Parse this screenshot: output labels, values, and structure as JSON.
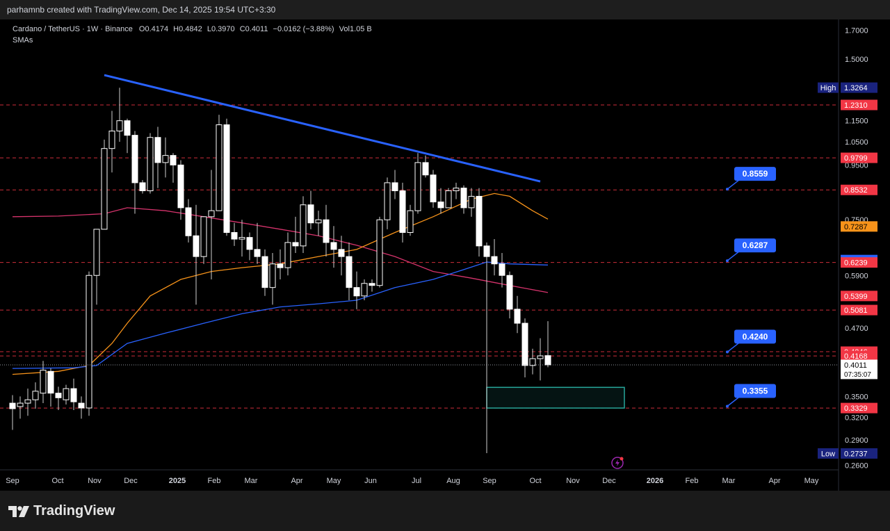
{
  "header": {
    "credit": "parhamnb created with TradingView.com, Dec 14, 2025 19:54 UTC+3:30"
  },
  "legend": {
    "symbol_line": "Cardano / TetherUS · 1W · Binance",
    "ohlc": {
      "open_label": "O",
      "open": "0.4174",
      "high_label": "H",
      "high": "0.4842",
      "low_label": "L",
      "low": "0.3970",
      "close_label": "C",
      "close": "0.4011",
      "change": "−0.0162 (−3.88%)",
      "vol_label": "Vol",
      "vol": "1.05 B"
    },
    "indicator": "SMAs"
  },
  "footer": {
    "brand": "TradingView"
  },
  "colors": {
    "background": "#000000",
    "candle_up": "#ffffff",
    "candle_down": "#ffffff",
    "wick": "#cfcfcf",
    "trendline": "#2962ff",
    "sma_orange": "#f7931a",
    "sma_red": "#d6336c",
    "sma_blue": "#2962ff",
    "level_line": "#f23645",
    "zone_border": "#26a69a"
  },
  "chart_data": {
    "type": "candlestick",
    "title": "Cardano / TetherUS · 1W · Binance",
    "y_scale": "log",
    "ylim": [
      0.255,
      1.78
    ],
    "y_ticks": [
      "1.7000",
      "1.5000",
      "1.1500",
      "1.0500",
      "0.9500",
      "0.7500",
      "0.5900",
      "0.4700",
      "0.3500",
      "0.3200",
      "0.2900",
      "0.2600"
    ],
    "x_ticks": [
      "Sep",
      "Oct",
      "Nov",
      "Dec",
      "2025",
      "Feb",
      "Mar",
      "Apr",
      "May",
      "Jun",
      "Jul",
      "Aug",
      "Sep",
      "Oct",
      "Nov",
      "Dec",
      "2026",
      "Feb",
      "Mar",
      "Apr",
      "May"
    ],
    "candles": [
      {
        "o": 0.34,
        "h": 0.352,
        "l": 0.303,
        "c": 0.332
      },
      {
        "o": 0.335,
        "h": 0.35,
        "l": 0.318,
        "c": 0.34
      },
      {
        "o": 0.34,
        "h": 0.362,
        "l": 0.322,
        "c": 0.345
      },
      {
        "o": 0.345,
        "h": 0.372,
        "l": 0.332,
        "c": 0.358
      },
      {
        "o": 0.355,
        "h": 0.408,
        "l": 0.34,
        "c": 0.392
      },
      {
        "o": 0.39,
        "h": 0.395,
        "l": 0.335,
        "c": 0.355
      },
      {
        "o": 0.355,
        "h": 0.365,
        "l": 0.33,
        "c": 0.348
      },
      {
        "o": 0.345,
        "h": 0.368,
        "l": 0.338,
        "c": 0.362
      },
      {
        "o": 0.362,
        "h": 0.378,
        "l": 0.33,
        "c": 0.342
      },
      {
        "o": 0.34,
        "h": 0.35,
        "l": 0.318,
        "c": 0.333
      },
      {
        "o": 0.333,
        "h": 0.6,
        "l": 0.322,
        "c": 0.59
      },
      {
        "o": 0.59,
        "h": 0.72,
        "l": 0.52,
        "c": 0.72
      },
      {
        "o": 0.72,
        "h": 1.06,
        "l": 0.72,
        "c": 1.02
      },
      {
        "o": 1.02,
        "h": 1.2,
        "l": 0.92,
        "c": 1.1
      },
      {
        "o": 1.1,
        "h": 1.326,
        "l": 1.05,
        "c": 1.15
      },
      {
        "o": 1.15,
        "h": 1.16,
        "l": 1.0,
        "c": 1.08
      },
      {
        "o": 1.08,
        "h": 1.1,
        "l": 0.77,
        "c": 0.88
      },
      {
        "o": 0.88,
        "h": 0.89,
        "l": 0.84,
        "c": 0.85
      },
      {
        "o": 0.85,
        "h": 1.09,
        "l": 0.84,
        "c": 1.07
      },
      {
        "o": 1.07,
        "h": 1.12,
        "l": 0.86,
        "c": 0.96
      },
      {
        "o": 0.96,
        "h": 1.07,
        "l": 0.9,
        "c": 0.99
      },
      {
        "o": 0.99,
        "h": 1.0,
        "l": 0.88,
        "c": 0.95
      },
      {
        "o": 0.95,
        "h": 0.97,
        "l": 0.75,
        "c": 0.79
      },
      {
        "o": 0.79,
        "h": 0.82,
        "l": 0.68,
        "c": 0.7
      },
      {
        "o": 0.7,
        "h": 0.8,
        "l": 0.52,
        "c": 0.64
      },
      {
        "o": 0.64,
        "h": 0.76,
        "l": 0.62,
        "c": 0.76
      },
      {
        "o": 0.76,
        "h": 0.93,
        "l": 0.58,
        "c": 0.78
      },
      {
        "o": 0.78,
        "h": 1.18,
        "l": 0.78,
        "c": 1.13
      },
      {
        "o": 1.13,
        "h": 1.16,
        "l": 0.7,
        "c": 0.71
      },
      {
        "o": 0.71,
        "h": 0.74,
        "l": 0.67,
        "c": 0.69
      },
      {
        "o": 0.69,
        "h": 0.75,
        "l": 0.64,
        "c": 0.695
      },
      {
        "o": 0.695,
        "h": 0.71,
        "l": 0.63,
        "c": 0.66
      },
      {
        "o": 0.66,
        "h": 0.74,
        "l": 0.62,
        "c": 0.64
      },
      {
        "o": 0.64,
        "h": 0.66,
        "l": 0.54,
        "c": 0.56
      },
      {
        "o": 0.56,
        "h": 0.65,
        "l": 0.52,
        "c": 0.62
      },
      {
        "o": 0.62,
        "h": 0.66,
        "l": 0.58,
        "c": 0.61
      },
      {
        "o": 0.61,
        "h": 0.71,
        "l": 0.59,
        "c": 0.68
      },
      {
        "o": 0.68,
        "h": 0.76,
        "l": 0.65,
        "c": 0.67
      },
      {
        "o": 0.67,
        "h": 0.83,
        "l": 0.65,
        "c": 0.8
      },
      {
        "o": 0.8,
        "h": 0.85,
        "l": 0.72,
        "c": 0.74
      },
      {
        "o": 0.74,
        "h": 0.78,
        "l": 0.7,
        "c": 0.75
      },
      {
        "o": 0.75,
        "h": 0.8,
        "l": 0.64,
        "c": 0.68
      },
      {
        "o": 0.68,
        "h": 0.73,
        "l": 0.61,
        "c": 0.66
      },
      {
        "o": 0.66,
        "h": 0.7,
        "l": 0.59,
        "c": 0.64
      },
      {
        "o": 0.64,
        "h": 0.68,
        "l": 0.53,
        "c": 0.56
      },
      {
        "o": 0.56,
        "h": 0.6,
        "l": 0.51,
        "c": 0.54
      },
      {
        "o": 0.54,
        "h": 0.58,
        "l": 0.53,
        "c": 0.57
      },
      {
        "o": 0.57,
        "h": 0.58,
        "l": 0.55,
        "c": 0.565
      },
      {
        "o": 0.565,
        "h": 0.76,
        "l": 0.56,
        "c": 0.75
      },
      {
        "o": 0.75,
        "h": 0.9,
        "l": 0.72,
        "c": 0.88
      },
      {
        "o": 0.88,
        "h": 0.93,
        "l": 0.82,
        "c": 0.85
      },
      {
        "o": 0.85,
        "h": 0.88,
        "l": 0.68,
        "c": 0.71
      },
      {
        "o": 0.71,
        "h": 0.8,
        "l": 0.7,
        "c": 0.78
      },
      {
        "o": 0.78,
        "h": 1.0,
        "l": 0.77,
        "c": 0.96
      },
      {
        "o": 0.96,
        "h": 0.99,
        "l": 0.9,
        "c": 0.91
      },
      {
        "o": 0.91,
        "h": 0.93,
        "l": 0.79,
        "c": 0.81
      },
      {
        "o": 0.81,
        "h": 0.86,
        "l": 0.77,
        "c": 0.79
      },
      {
        "o": 0.79,
        "h": 0.86,
        "l": 0.79,
        "c": 0.85
      },
      {
        "o": 0.85,
        "h": 0.88,
        "l": 0.82,
        "c": 0.86
      },
      {
        "o": 0.86,
        "h": 0.87,
        "l": 0.77,
        "c": 0.79
      },
      {
        "o": 0.79,
        "h": 0.86,
        "l": 0.76,
        "c": 0.83
      },
      {
        "o": 0.83,
        "h": 0.86,
        "l": 0.64,
        "c": 0.67
      },
      {
        "o": 0.67,
        "h": 0.68,
        "l": 0.274,
        "c": 0.64
      },
      {
        "o": 0.64,
        "h": 0.69,
        "l": 0.59,
        "c": 0.62
      },
      {
        "o": 0.62,
        "h": 0.65,
        "l": 0.56,
        "c": 0.59
      },
      {
        "o": 0.59,
        "h": 0.6,
        "l": 0.49,
        "c": 0.51
      },
      {
        "o": 0.51,
        "h": 0.54,
        "l": 0.46,
        "c": 0.48
      },
      {
        "o": 0.48,
        "h": 0.49,
        "l": 0.38,
        "c": 0.4
      },
      {
        "o": 0.4,
        "h": 0.43,
        "l": 0.385,
        "c": 0.412
      },
      {
        "o": 0.412,
        "h": 0.45,
        "l": 0.375,
        "c": 0.417
      },
      {
        "o": 0.4174,
        "h": 0.4842,
        "l": 0.397,
        "c": 0.4011
      }
    ],
    "sma_series": [
      {
        "color": "#d6336c",
        "values": [
          [
            0,
            0.76
          ],
          [
            6,
            0.762
          ],
          [
            12,
            0.77
          ],
          [
            15,
            0.79
          ],
          [
            20,
            0.78
          ],
          [
            25,
            0.76
          ],
          [
            30,
            0.74
          ],
          [
            35,
            0.72
          ],
          [
            40,
            0.7
          ],
          [
            45,
            0.672
          ],
          [
            50,
            0.64
          ],
          [
            55,
            0.6
          ],
          [
            60,
            0.583
          ],
          [
            65,
            0.565
          ],
          [
            70,
            0.548
          ]
        ]
      },
      {
        "color": "#f7931a",
        "values": [
          [
            0,
            0.385
          ],
          [
            6,
            0.39
          ],
          [
            10,
            0.4
          ],
          [
            13,
            0.44
          ],
          [
            15,
            0.48
          ],
          [
            18,
            0.54
          ],
          [
            22,
            0.58
          ],
          [
            26,
            0.6
          ],
          [
            30,
            0.61
          ],
          [
            35,
            0.62
          ],
          [
            40,
            0.64
          ],
          [
            45,
            0.66
          ],
          [
            50,
            0.71
          ],
          [
            55,
            0.76
          ],
          [
            60,
            0.82
          ],
          [
            63,
            0.84
          ],
          [
            65,
            0.83
          ],
          [
            68,
            0.78
          ],
          [
            70,
            0.752
          ]
        ]
      },
      {
        "color": "#2962ff",
        "values": [
          [
            0,
            0.395
          ],
          [
            8,
            0.396
          ],
          [
            11,
            0.4
          ],
          [
            15,
            0.44
          ],
          [
            20,
            0.46
          ],
          [
            25,
            0.48
          ],
          [
            30,
            0.5
          ],
          [
            35,
            0.515
          ],
          [
            40,
            0.522
          ],
          [
            45,
            0.53
          ],
          [
            50,
            0.56
          ],
          [
            55,
            0.58
          ],
          [
            59,
            0.605
          ],
          [
            62,
            0.625
          ],
          [
            65,
            0.62
          ],
          [
            70,
            0.617
          ]
        ]
      }
    ],
    "trendline": {
      "from": [
        12,
        1.4
      ],
      "to": [
        69,
        0.885
      ]
    },
    "horizontal_levels": [
      "1.2310",
      "0.9799",
      "0.8532",
      "0.6239",
      "0.5081",
      "0.4246",
      "0.4168",
      "0.3329"
    ],
    "price_labels": [
      {
        "text": "1.3264",
        "value": 1.3264,
        "bg": "#1a237e",
        "prefix": "High"
      },
      {
        "text": "1.2310",
        "value": 1.231,
        "bg": "#f23645"
      },
      {
        "text": "0.9799",
        "value": 0.9799,
        "bg": "#f23645"
      },
      {
        "text": "0.8532",
        "value": 0.8532,
        "bg": "#f23645"
      },
      {
        "text": "0.7287",
        "value": 0.7287,
        "bg": "#f7931a",
        "fg": "#000000"
      },
      {
        "text": "0.6304",
        "value": 0.6304,
        "bg": "#2962ff"
      },
      {
        "text": "0.6239",
        "value": 0.6239,
        "bg": "#f23645"
      },
      {
        "text": "0.5399",
        "value": 0.5399,
        "bg": "#f23645"
      },
      {
        "text": "0.5081",
        "value": 0.5081,
        "bg": "#f23645"
      },
      {
        "text": "0.4246",
        "value": 0.4246,
        "bg": "#f23645"
      },
      {
        "text": "0.4168",
        "value": 0.4168,
        "bg": "#f23645"
      },
      {
        "text": "0.4011",
        "value": 0.4011,
        "bg": "#ffffff",
        "fg": "#000000",
        "sub": "07:35:07"
      },
      {
        "text": "0.3329",
        "value": 0.3329,
        "bg": "#f23645"
      },
      {
        "text": "0.2737",
        "value": 0.2737,
        "bg": "#1a237e",
        "prefix": "Low"
      }
    ],
    "callouts": [
      {
        "text": "0.8559",
        "value": 0.8559
      },
      {
        "text": "0.6287",
        "value": 0.6287
      },
      {
        "text": "0.4240",
        "value": 0.424
      },
      {
        "text": "0.3355",
        "value": 0.3355
      }
    ],
    "zone": {
      "from_index": 62,
      "to_index": 80,
      "top": 0.364,
      "bottom": 0.3329
    }
  }
}
